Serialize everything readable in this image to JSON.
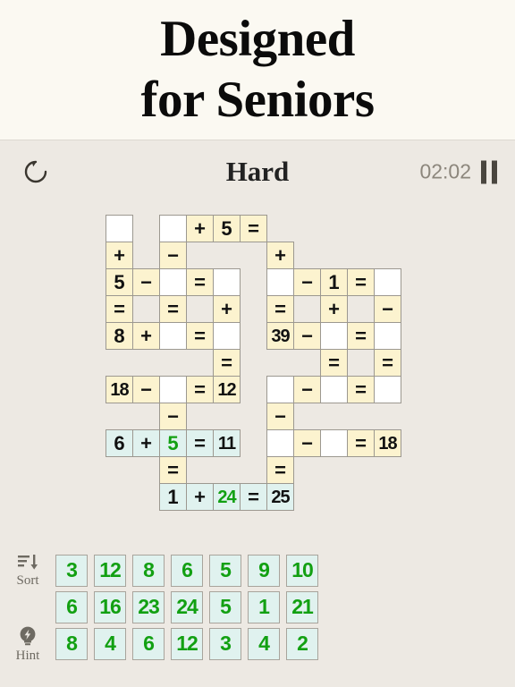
{
  "promo": {
    "line1": "Designed",
    "line2": "for Seniors"
  },
  "toolbar": {
    "refresh_icon": "refresh-icon",
    "difficulty": "Hard",
    "timer": "02:02",
    "pause_icon": "pause-icon"
  },
  "colors": {
    "page_bg": "#EDE9E3",
    "promo_bg": "#FBF9F2",
    "clue_cell": "#FCF3CF",
    "empty_cell": "#FFFFFF",
    "selected_cell": "#E0F2EF",
    "user_value": "#12A012",
    "tile_bg": "#E0F2EF",
    "text": "#111111",
    "muted": "#8C867C"
  },
  "grid": {
    "cols": 11,
    "rows": 11,
    "cell_size": 31,
    "cells": [
      {
        "r": 0,
        "c": 0,
        "t": "",
        "k": "blank"
      },
      {
        "r": 0,
        "c": 2,
        "t": "",
        "k": "blank"
      },
      {
        "r": 0,
        "c": 3,
        "t": "+",
        "k": "op"
      },
      {
        "r": 0,
        "c": 4,
        "t": "5",
        "k": "num"
      },
      {
        "r": 0,
        "c": 5,
        "t": "=",
        "k": "op"
      },
      {
        "r": 1,
        "c": 0,
        "t": "+",
        "k": "op"
      },
      {
        "r": 1,
        "c": 2,
        "t": "−",
        "k": "op"
      },
      {
        "r": 1,
        "c": 6,
        "t": "+",
        "k": "op"
      },
      {
        "r": 2,
        "c": 0,
        "t": "5",
        "k": "num"
      },
      {
        "r": 2,
        "c": 1,
        "t": "−",
        "k": "op"
      },
      {
        "r": 2,
        "c": 2,
        "t": "",
        "k": "blank"
      },
      {
        "r": 2,
        "c": 3,
        "t": "=",
        "k": "op"
      },
      {
        "r": 2,
        "c": 4,
        "t": "",
        "k": "blank"
      },
      {
        "r": 2,
        "c": 6,
        "t": "",
        "k": "blank"
      },
      {
        "r": 2,
        "c": 7,
        "t": "−",
        "k": "op"
      },
      {
        "r": 2,
        "c": 8,
        "t": "1",
        "k": "num"
      },
      {
        "r": 2,
        "c": 9,
        "t": "=",
        "k": "op"
      },
      {
        "r": 2,
        "c": 10,
        "t": "",
        "k": "blank"
      },
      {
        "r": 3,
        "c": 0,
        "t": "=",
        "k": "op"
      },
      {
        "r": 3,
        "c": 2,
        "t": "=",
        "k": "op"
      },
      {
        "r": 3,
        "c": 4,
        "t": "+",
        "k": "op"
      },
      {
        "r": 3,
        "c": 6,
        "t": "=",
        "k": "op"
      },
      {
        "r": 3,
        "c": 8,
        "t": "+",
        "k": "op"
      },
      {
        "r": 3,
        "c": 10,
        "t": "−",
        "k": "op"
      },
      {
        "r": 4,
        "c": 0,
        "t": "8",
        "k": "num"
      },
      {
        "r": 4,
        "c": 1,
        "t": "+",
        "k": "op"
      },
      {
        "r": 4,
        "c": 2,
        "t": "",
        "k": "blank"
      },
      {
        "r": 4,
        "c": 3,
        "t": "=",
        "k": "op"
      },
      {
        "r": 4,
        "c": 4,
        "t": "",
        "k": "blank"
      },
      {
        "r": 4,
        "c": 6,
        "t": "39",
        "k": "num",
        "small": true
      },
      {
        "r": 4,
        "c": 7,
        "t": "−",
        "k": "op"
      },
      {
        "r": 4,
        "c": 8,
        "t": "",
        "k": "blank"
      },
      {
        "r": 4,
        "c": 9,
        "t": "=",
        "k": "op"
      },
      {
        "r": 4,
        "c": 10,
        "t": "",
        "k": "blank"
      },
      {
        "r": 5,
        "c": 4,
        "t": "=",
        "k": "op"
      },
      {
        "r": 5,
        "c": 8,
        "t": "=",
        "k": "op"
      },
      {
        "r": 5,
        "c": 10,
        "t": "=",
        "k": "op"
      },
      {
        "r": 6,
        "c": 0,
        "t": "18",
        "k": "num",
        "small": true
      },
      {
        "r": 6,
        "c": 1,
        "t": "−",
        "k": "op"
      },
      {
        "r": 6,
        "c": 2,
        "t": "",
        "k": "blank"
      },
      {
        "r": 6,
        "c": 3,
        "t": "=",
        "k": "op"
      },
      {
        "r": 6,
        "c": 4,
        "t": "12",
        "k": "num",
        "small": true
      },
      {
        "r": 6,
        "c": 6,
        "t": "",
        "k": "blank"
      },
      {
        "r": 6,
        "c": 7,
        "t": "−",
        "k": "op"
      },
      {
        "r": 6,
        "c": 8,
        "t": "",
        "k": "blank"
      },
      {
        "r": 6,
        "c": 9,
        "t": "=",
        "k": "op"
      },
      {
        "r": 6,
        "c": 10,
        "t": "",
        "k": "blank"
      },
      {
        "r": 7,
        "c": 2,
        "t": "−",
        "k": "op"
      },
      {
        "r": 7,
        "c": 6,
        "t": "−",
        "k": "op"
      },
      {
        "r": 8,
        "c": 0,
        "t": "6",
        "k": "num",
        "sel": true
      },
      {
        "r": 8,
        "c": 1,
        "t": "+",
        "k": "op",
        "sel": true
      },
      {
        "r": 8,
        "c": 2,
        "t": "5",
        "k": "num",
        "sel": true,
        "user": true
      },
      {
        "r": 8,
        "c": 3,
        "t": "=",
        "k": "op",
        "sel": true
      },
      {
        "r": 8,
        "c": 4,
        "t": "11",
        "k": "num",
        "sel": true,
        "small": true
      },
      {
        "r": 8,
        "c": 6,
        "t": "",
        "k": "blank"
      },
      {
        "r": 8,
        "c": 7,
        "t": "−",
        "k": "op"
      },
      {
        "r": 8,
        "c": 8,
        "t": "",
        "k": "blank"
      },
      {
        "r": 8,
        "c": 9,
        "t": "=",
        "k": "op"
      },
      {
        "r": 8,
        "c": 10,
        "t": "18",
        "k": "num",
        "small": true
      },
      {
        "r": 9,
        "c": 2,
        "t": "=",
        "k": "op"
      },
      {
        "r": 9,
        "c": 6,
        "t": "=",
        "k": "op"
      },
      {
        "r": 10,
        "c": 2,
        "t": "1",
        "k": "num",
        "sel": true
      },
      {
        "r": 10,
        "c": 3,
        "t": "+",
        "k": "op",
        "sel": true
      },
      {
        "r": 10,
        "c": 4,
        "t": "24",
        "k": "num",
        "sel": true,
        "user": true,
        "small": true
      },
      {
        "r": 10,
        "c": 5,
        "t": "=",
        "k": "op",
        "sel": true
      },
      {
        "r": 10,
        "c": 6,
        "t": "25",
        "k": "num",
        "sel": true,
        "small": true
      }
    ]
  },
  "tray": {
    "sort_label": "Sort",
    "sort_icon": "sort-icon",
    "hint_label": "Hint",
    "hint_icon": "lightbulb-icon",
    "rows": [
      [
        "3",
        "12",
        "8",
        "6",
        "5",
        "9",
        "10"
      ],
      [
        "6",
        "16",
        "23",
        "24",
        "5",
        "1",
        "21"
      ],
      [
        "8",
        "4",
        "6",
        "12",
        "3",
        "4",
        "2"
      ]
    ]
  }
}
